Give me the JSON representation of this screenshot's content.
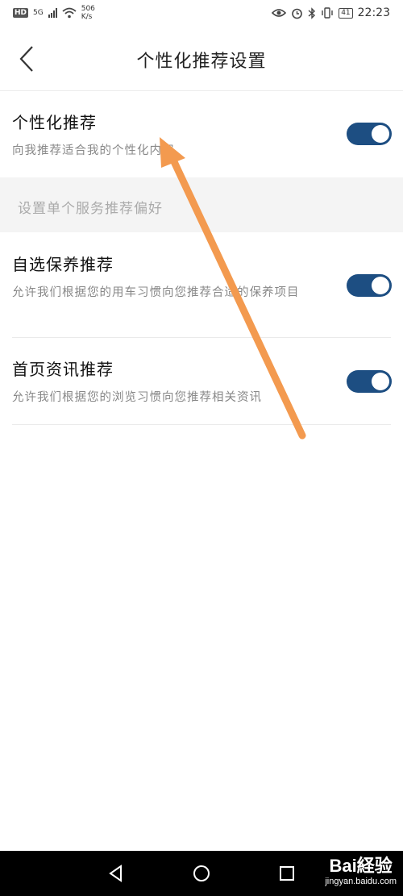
{
  "status_bar": {
    "hd": "HD",
    "network": "5G",
    "speed_value": "506",
    "speed_unit": "K/s",
    "battery": "41",
    "time": "22:23"
  },
  "header": {
    "title": "个性化推荐设置",
    "back_icon": "chevron-left-icon"
  },
  "main_setting": {
    "title": "个性化推荐",
    "description": "向我推荐适合我的个性化内容",
    "enabled": true
  },
  "group_header": "设置单个服务推荐偏好",
  "settings": [
    {
      "title": "自选保养推荐",
      "description": "允许我们根据您的用车习惯向您推荐合适的保养项目",
      "enabled": true
    },
    {
      "title": "首页资讯推荐",
      "description": "允许我们根据您的浏览习惯向您推荐相关资讯",
      "enabled": true
    }
  ],
  "nav_bar": {
    "back_icon": "triangle-back-icon",
    "home_icon": "circle-home-icon",
    "recents_icon": "square-recents-icon"
  },
  "watermark": {
    "brand": "Bai経验",
    "url": "jingyan.baidu.com"
  },
  "colors": {
    "toggle_on": "#1d4e82",
    "annotation_arrow": "#f39a4f",
    "group_header_bg": "#f4f4f4"
  }
}
